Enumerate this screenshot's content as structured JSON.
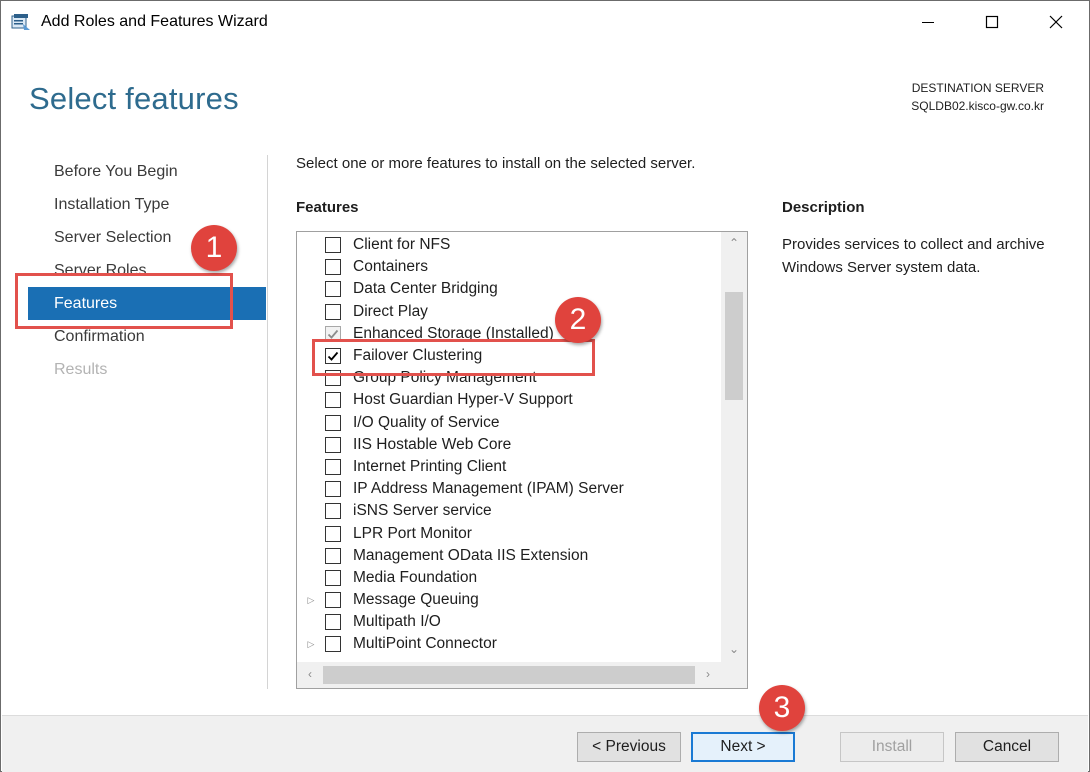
{
  "window": {
    "title": "Add Roles and Features Wizard",
    "controls": [
      "minimize-icon",
      "maximize-icon",
      "close-icon"
    ]
  },
  "page": {
    "title": "Select features",
    "destination_label": "DESTINATION SERVER",
    "destination_value": "SQLDB02.kisco-gw.co.kr"
  },
  "nav": {
    "items": [
      {
        "label": "Before You Begin",
        "state": "normal"
      },
      {
        "label": "Installation Type",
        "state": "normal"
      },
      {
        "label": "Server Selection",
        "state": "normal"
      },
      {
        "label": "Server Roles",
        "state": "normal"
      },
      {
        "label": "Features",
        "state": "active"
      },
      {
        "label": "Confirmation",
        "state": "normal"
      },
      {
        "label": "Results",
        "state": "disabled"
      }
    ]
  },
  "main": {
    "intro": "Select one or more features to install on the selected server.",
    "features_heading": "Features",
    "description_heading": "Description",
    "description_text": "Provides services to collect and archive Windows Server system data.",
    "features": [
      {
        "label": "Client for NFS",
        "checked": false,
        "expandable": false
      },
      {
        "label": "Containers",
        "checked": false,
        "expandable": false
      },
      {
        "label": "Data Center Bridging",
        "checked": false,
        "expandable": false
      },
      {
        "label": "Direct Play",
        "checked": false,
        "expandable": false
      },
      {
        "label": "Enhanced Storage (Installed)",
        "checked": true,
        "dim": true,
        "expandable": false
      },
      {
        "label": "Failover Clustering",
        "checked": true,
        "expandable": false
      },
      {
        "label": "Group Policy Management",
        "checked": false,
        "expandable": false
      },
      {
        "label": "Host Guardian Hyper-V Support",
        "checked": false,
        "expandable": false
      },
      {
        "label": "I/O Quality of Service",
        "checked": false,
        "expandable": false
      },
      {
        "label": "IIS Hostable Web Core",
        "checked": false,
        "expandable": false
      },
      {
        "label": "Internet Printing Client",
        "checked": false,
        "expandable": false
      },
      {
        "label": "IP Address Management (IPAM) Server",
        "checked": false,
        "expandable": false
      },
      {
        "label": "iSNS Server service",
        "checked": false,
        "expandable": false
      },
      {
        "label": "LPR Port Monitor",
        "checked": false,
        "expandable": false
      },
      {
        "label": "Management OData IIS Extension",
        "checked": false,
        "expandable": false
      },
      {
        "label": "Media Foundation",
        "checked": false,
        "expandable": false
      },
      {
        "label": "Message Queuing",
        "checked": false,
        "expandable": true
      },
      {
        "label": "Multipath I/O",
        "checked": false,
        "expandable": false
      },
      {
        "label": "MultiPoint Connector",
        "checked": false,
        "expandable": true
      }
    ]
  },
  "buttons": {
    "previous": "< Previous",
    "next": "Next >",
    "install": "Install",
    "cancel": "Cancel"
  },
  "annotations": {
    "badge1": "1",
    "badge2": "2",
    "badge3": "3",
    "color": "#e0433d"
  },
  "colors": {
    "title": "#2e6b8e",
    "nav_active": "#1a6fb4",
    "default_button_border": "#1a7ad4"
  }
}
